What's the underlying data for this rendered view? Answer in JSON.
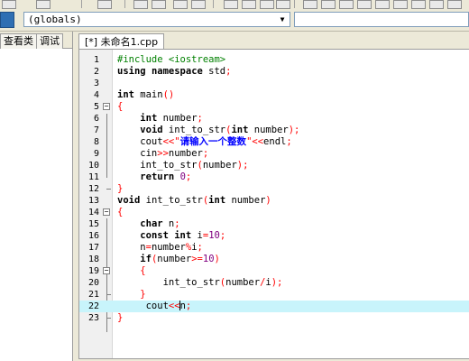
{
  "toolbar": {
    "scope_select_value": "(globals)"
  },
  "left_panel": {
    "tabs": [
      "查看类",
      "调试"
    ]
  },
  "editor": {
    "file_tab_label": "[*] 未命名1.cpp",
    "lines": [
      {
        "n": "1",
        "code": "#include <iostream>"
      },
      {
        "n": "2",
        "code": "using namespace std;"
      },
      {
        "n": "3",
        "code": ""
      },
      {
        "n": "4",
        "code": "int main()"
      },
      {
        "n": "5",
        "code": "{"
      },
      {
        "n": "6",
        "code": "    int number;"
      },
      {
        "n": "7",
        "code": "    void int_to_str(int number);"
      },
      {
        "n": "8",
        "code": "    cout<<\"请输入一个整数\"<<endl;"
      },
      {
        "n": "9",
        "code": "    cin>>number;"
      },
      {
        "n": "10",
        "code": "    int_to_str(number);"
      },
      {
        "n": "11",
        "code": "    return 0;"
      },
      {
        "n": "12",
        "code": "}"
      },
      {
        "n": "13",
        "code": "void int_to_str(int number)"
      },
      {
        "n": "14",
        "code": "{"
      },
      {
        "n": "15",
        "code": "    char n;"
      },
      {
        "n": "16",
        "code": "    const int i=10;"
      },
      {
        "n": "17",
        "code": "    n=number%i;"
      },
      {
        "n": "18",
        "code": "    if(number>=10)"
      },
      {
        "n": "19",
        "code": "    {"
      },
      {
        "n": "20",
        "code": "        int_to_str(number/i);"
      },
      {
        "n": "21",
        "code": "    }"
      },
      {
        "n": "22",
        "code": "     cout<<n;"
      },
      {
        "n": "23",
        "code": "}"
      }
    ],
    "current_line": "22",
    "colors": {
      "current_line_bg": "#c8f4fb",
      "keyword": "#000000",
      "preprocessor": "#008000",
      "operator": "#ff0000",
      "number": "#800080",
      "string": "#0000ff"
    }
  }
}
